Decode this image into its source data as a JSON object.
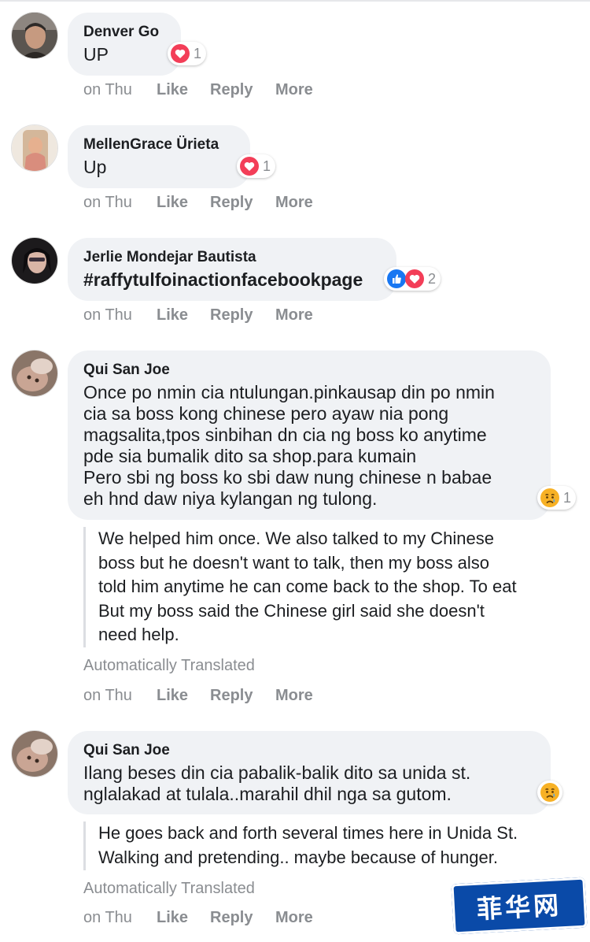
{
  "comments": [
    {
      "author": "Denver Go",
      "lines": [
        "UP"
      ],
      "reaction_count": "1",
      "actions": {
        "time": "on Thu",
        "like": "Like",
        "reply": "Reply",
        "more": "More"
      }
    },
    {
      "author": "MellenGrace Ürieta",
      "lines": [
        "Up"
      ],
      "reaction_count": "1",
      "actions": {
        "time": "on Thu",
        "like": "Like",
        "reply": "Reply",
        "more": "More"
      }
    },
    {
      "author": "Jerlie Mondejar Bautista",
      "lines": [
        "#raffytulfoinactionfacebookpage"
      ],
      "reaction_count": "2",
      "actions": {
        "time": "on Thu",
        "like": "Like",
        "reply": "Reply",
        "more": "More"
      }
    },
    {
      "author": "Qui San Joe",
      "lines": [
        "Once po nmin cia ntulungan.pinkausap din po nmin",
        "cia sa boss kong chinese pero ayaw nia pong",
        "magsalita,tpos sinbihan dn cia ng boss ko anytime",
        "pde sia bumalik dito sa shop.para kumain",
        "Pero sbi ng boss ko sbi daw nung chinese n babae",
        "eh hnd daw niya kylangan ng tulong."
      ],
      "reaction_count": "1",
      "translation": [
        "We helped him once. We also talked to my Chinese",
        "boss but he doesn't want to talk, then my boss also",
        "told him anytime he can come back to the shop. To eat",
        "But my boss said the Chinese girl said she doesn't",
        "need help."
      ],
      "translated_label": "Automatically Translated",
      "actions": {
        "time": "on Thu",
        "like": "Like",
        "reply": "Reply",
        "more": "More"
      }
    },
    {
      "author": "Qui San Joe",
      "lines": [
        "Ilang beses din cia pabalik-balik dito sa unida st.",
        "nglalakad at tulala..marahil dhil nga sa gutom."
      ],
      "translation": [
        "He goes back and forth several times here in Unida St.",
        "Walking and pretending.. maybe because of hunger."
      ],
      "translated_label": "Automatically Translated",
      "actions": {
        "time": "on Thu",
        "like": "Like",
        "reply": "Reply",
        "more": "More"
      }
    }
  ],
  "watermark": "菲华网",
  "colors": {
    "bubble": "#f0f2f5",
    "meta_text": "#8a8d91",
    "love": "#f33e58",
    "like": "#1877f2",
    "sad": "#f7b125"
  }
}
